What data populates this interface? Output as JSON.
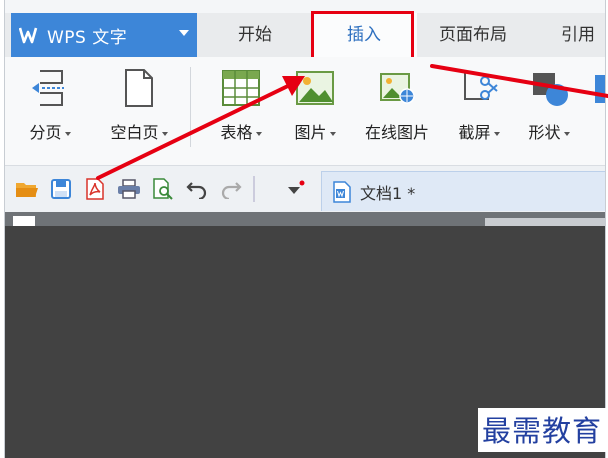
{
  "app": {
    "name": "WPS 文字"
  },
  "tabs": {
    "home": "开始",
    "insert": "插入",
    "layout": "页面布局",
    "references": "引用"
  },
  "ribbon": {
    "page_break": "分页",
    "blank_page": "空白页",
    "table": "表格",
    "picture": "图片",
    "online_picture": "在线图片",
    "screenshot": "截屏",
    "shapes": "形状"
  },
  "document": {
    "tab_name": "文档1 *"
  },
  "watermark": "最需教育",
  "colors": {
    "app_blue": "#3d86d8",
    "annotation_red": "#e60012",
    "workspace": "#424242"
  }
}
